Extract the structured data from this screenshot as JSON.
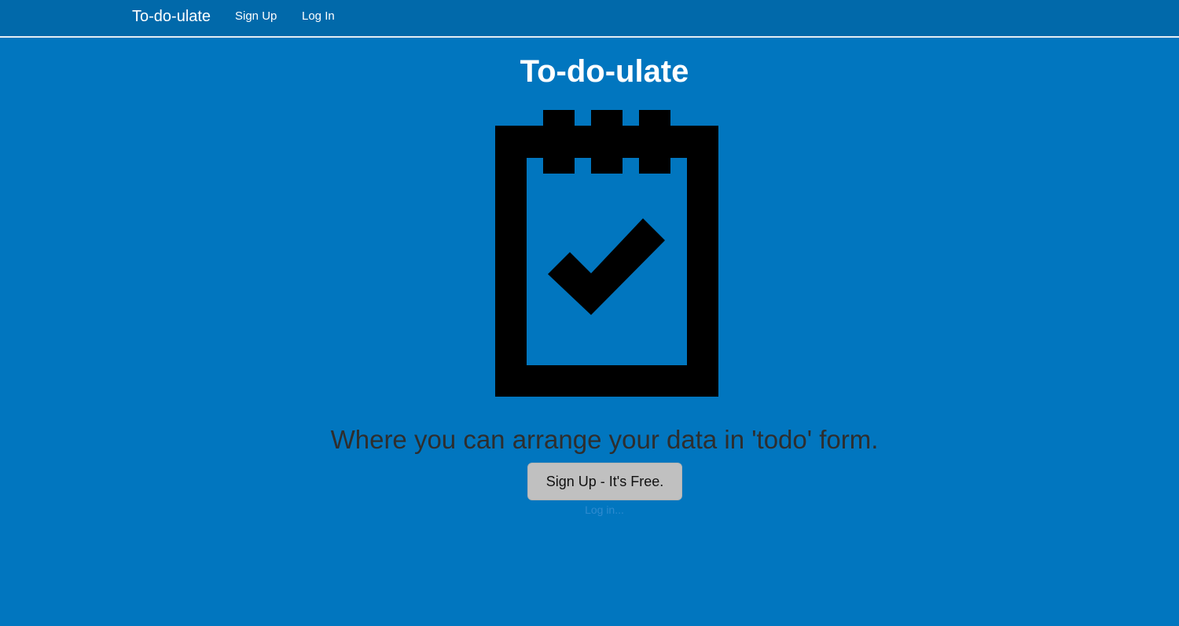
{
  "nav": {
    "brand": "To-do-ulate",
    "links": [
      {
        "label": "Sign Up"
      },
      {
        "label": "Log In"
      }
    ]
  },
  "hero": {
    "title": "To-do-ulate",
    "logo_icon": "notepad-check-icon",
    "tagline": "Where you can arrange your data in 'todo' form.",
    "cta_label": "Sign Up - It's Free.",
    "login_label": "Log in..."
  },
  "colors": {
    "page_background": "#0176bf",
    "navbar_background": "#0169aa",
    "button_background": "#c0c0c0",
    "logo": "#000000"
  }
}
